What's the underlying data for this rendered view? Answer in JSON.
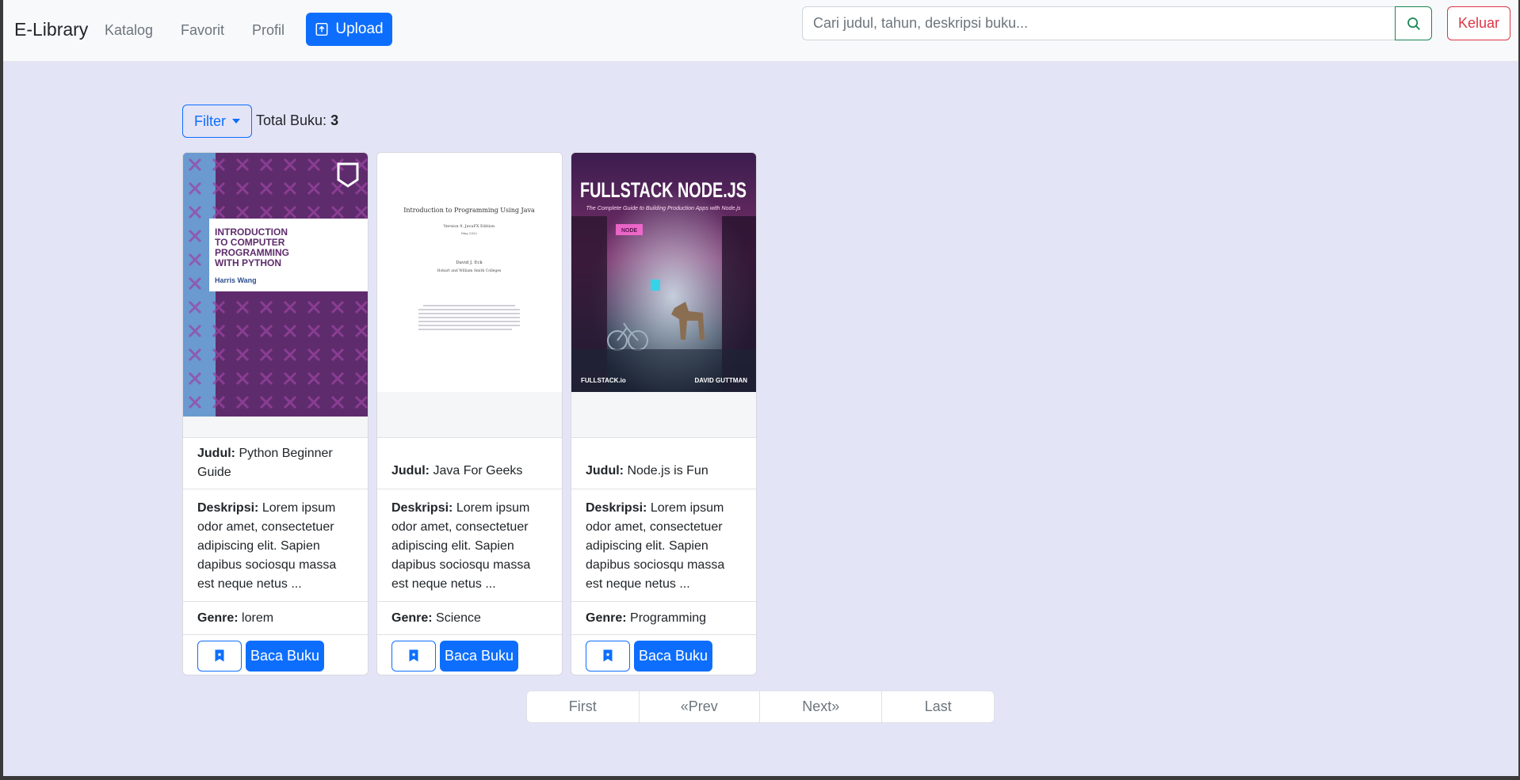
{
  "navbar": {
    "brand": "E-Library",
    "links": [
      "Katalog",
      "Favorit",
      "Profil"
    ],
    "upload_label": "Upload",
    "search_placeholder": "Cari judul, tahun, deskripsi buku...",
    "logout_label": "Keluar"
  },
  "toolbar": {
    "filter_label": "Filter",
    "total_label": "Total Buku:",
    "total_value": "3"
  },
  "books": [
    {
      "title_label": "Judul:",
      "title": "Python Beginner Guide",
      "desc_label": "Deskripsi:",
      "desc": "Lorem ipsum odor amet, consectetuer adipiscing elit. Sapien dapibus sociosqu massa est neque netus ...",
      "genre_label": "Genre:",
      "genre": "lorem",
      "read_label": "Baca Buku",
      "cover": {
        "lines": [
          "INTRODUCTION",
          "TO COMPUTER",
          "PROGRAMMING",
          "WITH PYTHON"
        ],
        "author": "Harris Wang"
      }
    },
    {
      "title_label": "Judul:",
      "title": "Java For Geeks",
      "desc_label": "Deskripsi:",
      "desc": "Lorem ipsum odor amet, consectetuer adipiscing elit. Sapien dapibus sociosqu massa est neque netus ...",
      "genre_label": "Genre:",
      "genre": "Science",
      "read_label": "Baca Buku",
      "cover": {
        "title": "Introduction to Programming Using Java",
        "edition": "Version 9, JavaFX Edition",
        "date": "May 2022",
        "author": "David J. Eck",
        "affiliation": "Hobart and William Smith Colleges"
      }
    },
    {
      "title_label": "Judul:",
      "title": "Node.js is Fun",
      "desc_label": "Deskripsi:",
      "desc": "Lorem ipsum odor amet, consectetuer adipiscing elit. Sapien dapibus sociosqu massa est neque netus ...",
      "genre_label": "Genre:",
      "genre": "Programming",
      "read_label": "Baca Buku",
      "cover": {
        "title": "FULLSTACK NODE.JS",
        "subtitle": "The Complete Guide to Building Production Apps with Node.js",
        "publisher": "FULLSTACK.io",
        "author": "DAVID GUTTMAN",
        "sign": "NODE"
      }
    }
  ],
  "pagination": [
    "First",
    "«Prev",
    "Next»",
    "Last"
  ],
  "colors": {
    "primary": "#0d6efd",
    "success": "#198754",
    "danger": "#dc3545",
    "page_bg": "#e4e4f7"
  }
}
